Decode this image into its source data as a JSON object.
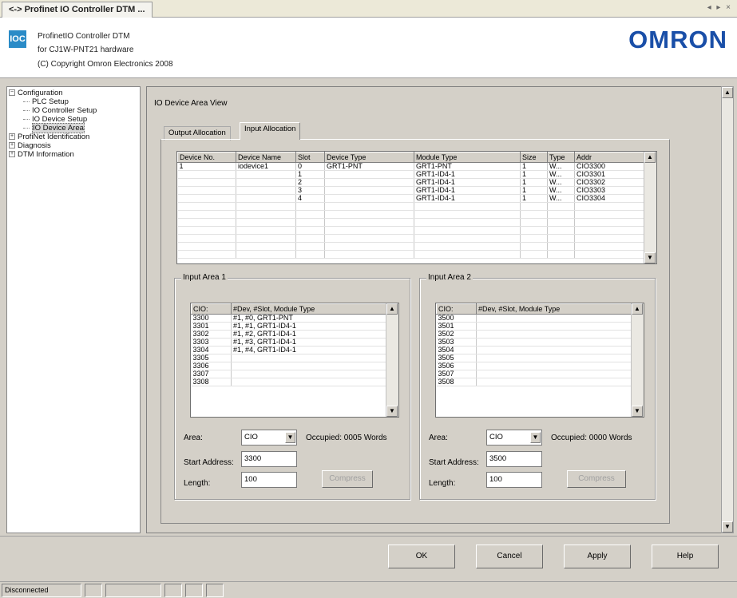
{
  "window": {
    "tab_title": "<-> Profinet IO Controller DTM ...",
    "controls": "◂ ▸ ×"
  },
  "header": {
    "logo_text": "IOC",
    "line1": "ProfinetIO Controller DTM",
    "line2": "for CJ1W-PNT21 hardware",
    "line3": "(C) Copyright Omron Electronics 2008",
    "brand": "OMRON",
    "brand_color": "#1a4fa8"
  },
  "tree": {
    "configuration": "Configuration",
    "plc_setup": "PLC Setup",
    "io_controller_setup": "IO Controller Setup",
    "io_device_setup": "IO Device Setup",
    "io_device_area": "IO Device Area",
    "profinet_identification": "ProfiNet Identification",
    "diagnosis": "Diagnosis",
    "dtm_information": "DTM Information"
  },
  "main": {
    "area_title": "IO Device Area View",
    "tabs": {
      "output": "Output Allocation",
      "input": "Input Allocation"
    },
    "table": {
      "headers": [
        "Device No.",
        "Device Name",
        "Slot",
        "Device Type",
        "Module Type",
        "Size",
        "Type",
        "Addr"
      ],
      "rows": [
        [
          "1",
          "iodevice1",
          "0",
          "GRT1-PNT",
          "GRT1-PNT",
          "1",
          "W...",
          "CIO3300"
        ],
        [
          "",
          "",
          "1",
          "",
          "GRT1-ID4-1",
          "1",
          "W...",
          "CIO3301"
        ],
        [
          "",
          "",
          "2",
          "",
          "GRT1-ID4-1",
          "1",
          "W...",
          "CIO3302"
        ],
        [
          "",
          "",
          "3",
          "",
          "GRT1-ID4-1",
          "1",
          "W...",
          "CIO3303"
        ],
        [
          "",
          "",
          "4",
          "",
          "GRT1-ID4-1",
          "1",
          "W...",
          "CIO3304"
        ],
        [
          "",
          "",
          "",
          "",
          "",
          "",
          "",
          ""
        ],
        [
          "",
          "",
          "",
          "",
          "",
          "",
          "",
          ""
        ],
        [
          "",
          "",
          "",
          "",
          "",
          "",
          "",
          ""
        ],
        [
          "",
          "",
          "",
          "",
          "",
          "",
          "",
          ""
        ],
        [
          "",
          "",
          "",
          "",
          "",
          "",
          "",
          ""
        ],
        [
          "",
          "",
          "",
          "",
          "",
          "",
          "",
          ""
        ],
        [
          "",
          "",
          "",
          "",
          "",
          "",
          "",
          ""
        ]
      ]
    },
    "area1": {
      "title": "Input Area 1",
      "headers": [
        "CIO:",
        "#Dev, #Slot, Module Type"
      ],
      "rows": [
        [
          "3300",
          "#1,  #0,  GRT1-PNT"
        ],
        [
          "3301",
          "#1,  #1,  GRT1-ID4-1"
        ],
        [
          "3302",
          "#1,  #2,  GRT1-ID4-1"
        ],
        [
          "3303",
          "#1,  #3,  GRT1-ID4-1"
        ],
        [
          "3304",
          "#1,  #4,  GRT1-ID4-1"
        ],
        [
          "3305",
          ""
        ],
        [
          "3306",
          ""
        ],
        [
          "3307",
          ""
        ],
        [
          "3308",
          ""
        ]
      ],
      "area_label": "Area:",
      "area_value": "CIO",
      "occupied": "Occupied: 0005  Words",
      "start_label": "Start Address:",
      "start_value": "3300",
      "length_label": "Length:",
      "length_value": "100",
      "compress": "Compress"
    },
    "area2": {
      "title": "Input Area 2",
      "headers": [
        "CIO:",
        "#Dev, #Slot, Module Type"
      ],
      "rows": [
        [
          "3500",
          ""
        ],
        [
          "3501",
          ""
        ],
        [
          "3502",
          ""
        ],
        [
          "3503",
          ""
        ],
        [
          "3504",
          ""
        ],
        [
          "3505",
          ""
        ],
        [
          "3506",
          ""
        ],
        [
          "3507",
          ""
        ],
        [
          "3508",
          ""
        ]
      ],
      "area_label": "Area:",
      "area_value": "CIO",
      "occupied": "Occupied: 0000  Words",
      "start_label": "Start Address:",
      "start_value": "3500",
      "length_label": "Length:",
      "length_value": "100",
      "compress": "Compress"
    }
  },
  "buttons": {
    "ok": "OK",
    "cancel": "Cancel",
    "apply": "Apply",
    "help": "Help"
  },
  "status": {
    "connection": "Disconnected"
  }
}
